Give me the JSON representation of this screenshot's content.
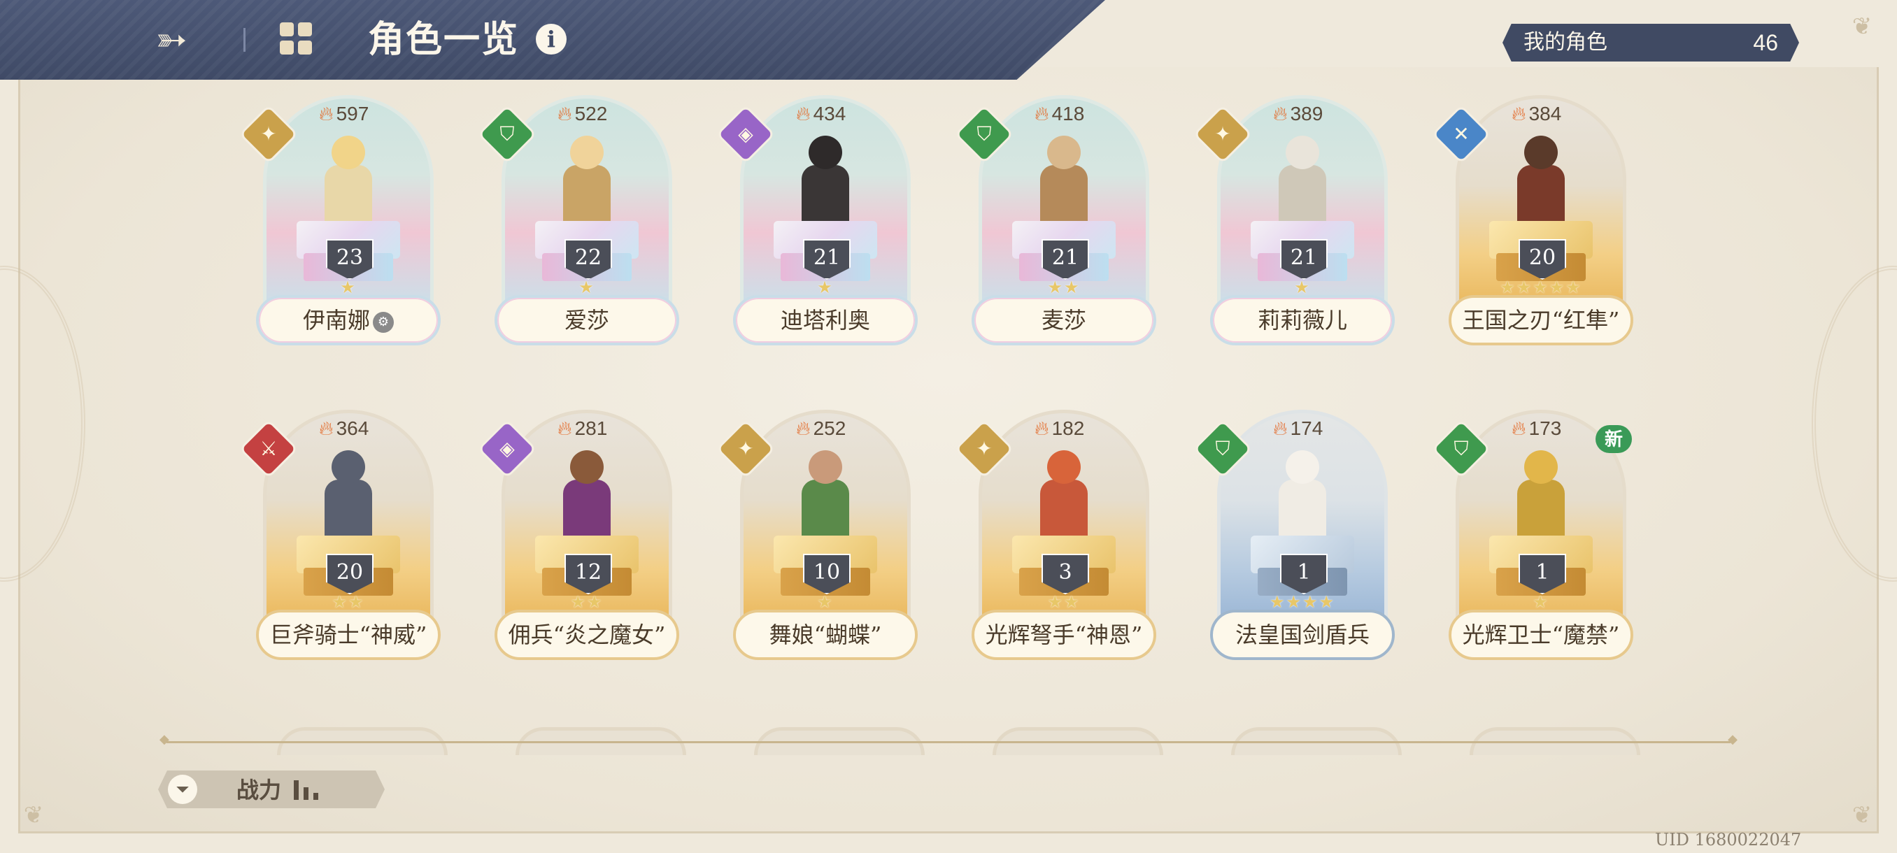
{
  "header": {
    "title": "角色一览",
    "back_icon": "back-arrow-icon",
    "grid_icon": "grid-icon",
    "info_icon": "info-icon",
    "info_glyph": "i"
  },
  "my_characters": {
    "label": "我的角色",
    "count": "46"
  },
  "cards": [
    {
      "name": "伊南娜",
      "power": "597",
      "level": "23",
      "stars": "★",
      "element": "light",
      "frame": "pastel",
      "has_meta_icon": true
    },
    {
      "name": "爱莎",
      "power": "522",
      "level": "22",
      "stars": "★",
      "element": "wind",
      "frame": "pastel"
    },
    {
      "name": "迪塔利奥",
      "power": "434",
      "level": "21",
      "stars": "★",
      "element": "dark",
      "frame": "pastel"
    },
    {
      "name": "麦莎",
      "power": "418",
      "level": "21",
      "stars": "★★",
      "element": "wind",
      "frame": "pastel"
    },
    {
      "name": "莉莉薇儿",
      "power": "389",
      "level": "21",
      "stars": "★",
      "element": "light",
      "frame": "pastel"
    },
    {
      "name": "王国之刃“红隼”",
      "power": "384",
      "level": "20",
      "stars": "★★★★★",
      "element": "ice",
      "frame": "gold"
    },
    {
      "name": "巨斧骑士“神威”",
      "power": "364",
      "level": "20",
      "stars": "★★",
      "element": "fire",
      "frame": "gold"
    },
    {
      "name": "佣兵“炎之魔女”",
      "power": "281",
      "level": "12",
      "stars": "★★",
      "element": "dark",
      "frame": "gold"
    },
    {
      "name": "舞娘“蝴蝶”",
      "power": "252",
      "level": "10",
      "stars": "★",
      "element": "light",
      "frame": "gold"
    },
    {
      "name": "光辉弩手“神恩”",
      "power": "182",
      "level": "3",
      "stars": "★★",
      "element": "light",
      "frame": "gold"
    },
    {
      "name": "法皇国剑盾兵",
      "power": "174",
      "level": "1",
      "stars": "★★★★",
      "element": "wind",
      "frame": "blue"
    },
    {
      "name": "光辉卫士“魔禁”",
      "power": "173",
      "level": "1",
      "stars": "★",
      "element": "wind",
      "frame": "gold",
      "new": "新"
    }
  ],
  "sort": {
    "label": "战力",
    "icon": "filter-icon"
  },
  "uid": "UID 1680022047",
  "colors": {
    "header": "#45506d",
    "background": "#efe9dc",
    "new_badge": "#3a9a57"
  }
}
